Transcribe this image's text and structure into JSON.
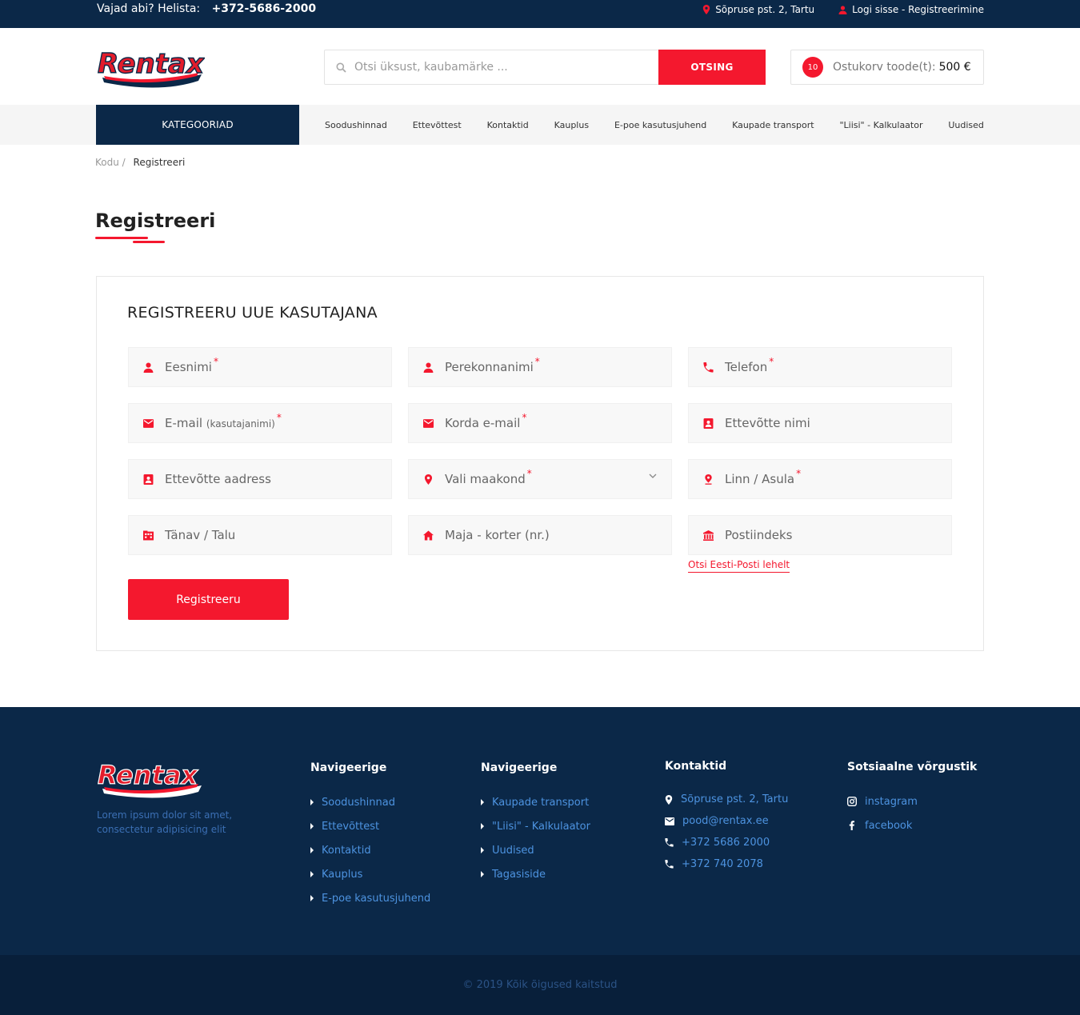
{
  "topbar": {
    "help_text": "Vajad abi? Helista:",
    "phone": "+372-5686-2000",
    "address": "Sõpruse pst. 2, Tartu",
    "login": "Logi sisse - Registreerimine"
  },
  "header": {
    "logo_text": "Rentax",
    "search_placeholder": "Otsi üksust, kaubamärke ...",
    "search_button": "OTSING",
    "cart_count": "10",
    "cart_label": "Ostukorv  toode(t):",
    "cart_total": "500 €"
  },
  "nav": {
    "categories": "KATEGOORIAD",
    "items": [
      "Soodushinnad",
      "Ettevõttest",
      "Kontaktid",
      "Kauplus",
      "E-poe kasutusjuhend",
      "Kaupade transport",
      "\"Liisi\" - Kalkulaator",
      "Uudised"
    ]
  },
  "breadcrumb": {
    "home": "Kodu",
    "separator": "/",
    "current": "Registreeri"
  },
  "page": {
    "title": "Registreeri"
  },
  "form": {
    "heading": "REGISTREERU UUE KASUTAJANA",
    "fields": {
      "eesnimi": "Eesnimi",
      "perekonnanimi": "Perekonnanimi",
      "telefon": "Telefon",
      "email": "E-mail",
      "email_hint": "(kasutajanimi)",
      "korda_email": "Korda e-mail",
      "ettevotte_nimi": "Ettevõtte nimi",
      "ettevotte_aadress": "Ettevõtte aadress",
      "maakond": "Vali maakond",
      "linn": "Linn / Asula",
      "tanav": "Tänav / Talu",
      "maja": "Maja - korter (nr.)",
      "postiindeks": "Postiindeks"
    },
    "required_mark": "*",
    "post_link": "Otsi Eesti-Posti lehelt",
    "submit": "Registreeru"
  },
  "footer": {
    "logo_text": "Rentax",
    "description": "Lorem ipsum dolor sit amet, consectetur adipisicing elit",
    "nav1": {
      "title": "Navigeerige",
      "items": [
        "Soodushinnad",
        "Ettevõttest",
        "Kontaktid",
        "Kauplus",
        "E-poe kasutusjuhend"
      ]
    },
    "nav2": {
      "title": "Navigeerige",
      "items": [
        "Kaupade transport",
        "\"Liisi\" - Kalkulaator",
        "Uudised",
        "Tagasiside"
      ]
    },
    "contact": {
      "title": "Kontaktid",
      "address": "Sõpruse pst. 2, Tartu",
      "email": "pood@rentax.ee",
      "phone1": "+372 5686 2000",
      "phone2": "+372 740 2078"
    },
    "social": {
      "title": "Sotsiaalne võrgustik",
      "instagram": "instagram",
      "facebook": "facebook"
    },
    "copyright": "© 2019 Kõik õigused kaitstud"
  },
  "colors": {
    "accent": "#f4182e",
    "navy": "#0b2848",
    "link": "#4d93e0"
  }
}
